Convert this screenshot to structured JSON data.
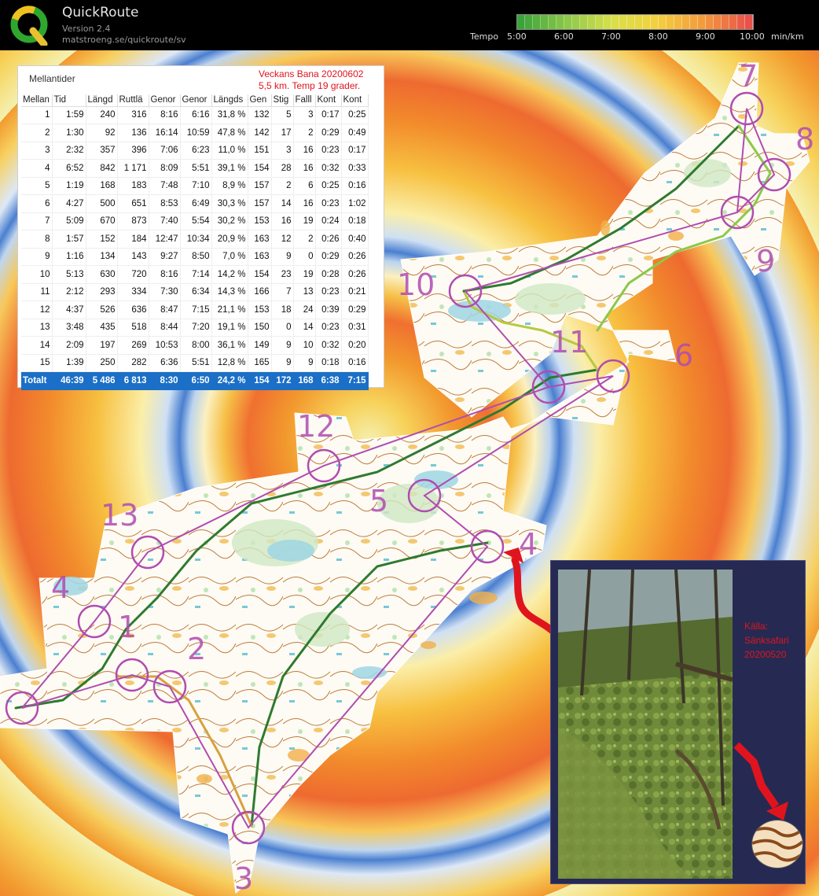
{
  "app": {
    "name": "QuickRoute",
    "version": "Version 2.4",
    "url": "matstroeng.se/quickroute/sv"
  },
  "tempo_scale": {
    "label": "Tempo",
    "ticks": [
      "5:00",
      "6:00",
      "7:00",
      "8:00",
      "9:00",
      "10:00"
    ],
    "unit": "min/km",
    "colors": [
      "#3aa43a",
      "#8cc84a",
      "#d8e04a",
      "#f4d040",
      "#f39a3c",
      "#e8524a"
    ]
  },
  "notes": {
    "line1": "Veckans Bana 20200602",
    "line2": "5,5 km. Temp 19 grader."
  },
  "splits": {
    "title": "Mellantider",
    "columns": [
      "Mellan",
      "Tid",
      "Längd",
      "Ruttlä",
      "Genor",
      "Genor",
      "Längds",
      "Gen",
      "Stig",
      "Falll",
      "Kont",
      "Kont"
    ],
    "rows": [
      [
        "1",
        "1:59",
        "240",
        "316",
        "8:16",
        "6:16",
        "31,8 %",
        "132",
        "5",
        "3",
        "0:17",
        "0:25"
      ],
      [
        "2",
        "1:30",
        "92",
        "136",
        "16:14",
        "10:59",
        "47,8 %",
        "142",
        "17",
        "2",
        "0:29",
        "0:49"
      ],
      [
        "3",
        "2:32",
        "357",
        "396",
        "7:06",
        "6:23",
        "11,0 %",
        "151",
        "3",
        "16",
        "0:23",
        "0:17"
      ],
      [
        "4",
        "6:52",
        "842",
        "1 171",
        "8:09",
        "5:51",
        "39,1 %",
        "154",
        "28",
        "16",
        "0:32",
        "0:33"
      ],
      [
        "5",
        "1:19",
        "168",
        "183",
        "7:48",
        "7:10",
        "8,9 %",
        "157",
        "2",
        "6",
        "0:25",
        "0:16"
      ],
      [
        "6",
        "4:27",
        "500",
        "651",
        "8:53",
        "6:49",
        "30,3 %",
        "157",
        "14",
        "16",
        "0:23",
        "1:02"
      ],
      [
        "7",
        "5:09",
        "670",
        "873",
        "7:40",
        "5:54",
        "30,2 %",
        "153",
        "16",
        "19",
        "0:24",
        "0:18"
      ],
      [
        "8",
        "1:57",
        "152",
        "184",
        "12:47",
        "10:34",
        "20,9 %",
        "163",
        "12",
        "2",
        "0:26",
        "0:40"
      ],
      [
        "9",
        "1:16",
        "134",
        "143",
        "9:27",
        "8:50",
        "7,0 %",
        "163",
        "9",
        "0",
        "0:29",
        "0:26"
      ],
      [
        "10",
        "5:13",
        "630",
        "720",
        "8:16",
        "7:14",
        "14,2 %",
        "154",
        "23",
        "19",
        "0:28",
        "0:26"
      ],
      [
        "11",
        "2:12",
        "293",
        "334",
        "7:30",
        "6:34",
        "14,3 %",
        "166",
        "7",
        "13",
        "0:23",
        "0:21"
      ],
      [
        "12",
        "4:37",
        "526",
        "636",
        "8:47",
        "7:15",
        "21,1 %",
        "153",
        "18",
        "24",
        "0:39",
        "0:29"
      ],
      [
        "13",
        "3:48",
        "435",
        "518",
        "8:44",
        "7:20",
        "19,1 %",
        "150",
        "0",
        "14",
        "0:23",
        "0:31"
      ],
      [
        "14",
        "2:09",
        "197",
        "269",
        "10:53",
        "8:00",
        "36,1 %",
        "149",
        "9",
        "10",
        "0:32",
        "0:20"
      ],
      [
        "15",
        "1:39",
        "250",
        "282",
        "6:36",
        "5:51",
        "12,8 %",
        "165",
        "9",
        "9",
        "0:18",
        "0:16"
      ]
    ],
    "total": [
      "Totalt",
      "46:39",
      "5 486",
      "6 813",
      "8:30",
      "6:50",
      "24,2 %",
      "154",
      "172",
      "168",
      "6:38",
      "7:15"
    ]
  },
  "control_labels": [
    "1",
    "2",
    "3",
    "4",
    "4",
    "5",
    "6",
    "7",
    "8",
    "9",
    "10",
    "11",
    "12",
    "13"
  ],
  "credit": {
    "line1": "Källa:",
    "line2": "Sänksafari",
    "line3": "20200520"
  },
  "colors": {
    "course": "#b04cb0",
    "annotation_red": "#e0141e",
    "total_row": "#1b6fc6",
    "photo_panel": "#262a52"
  }
}
